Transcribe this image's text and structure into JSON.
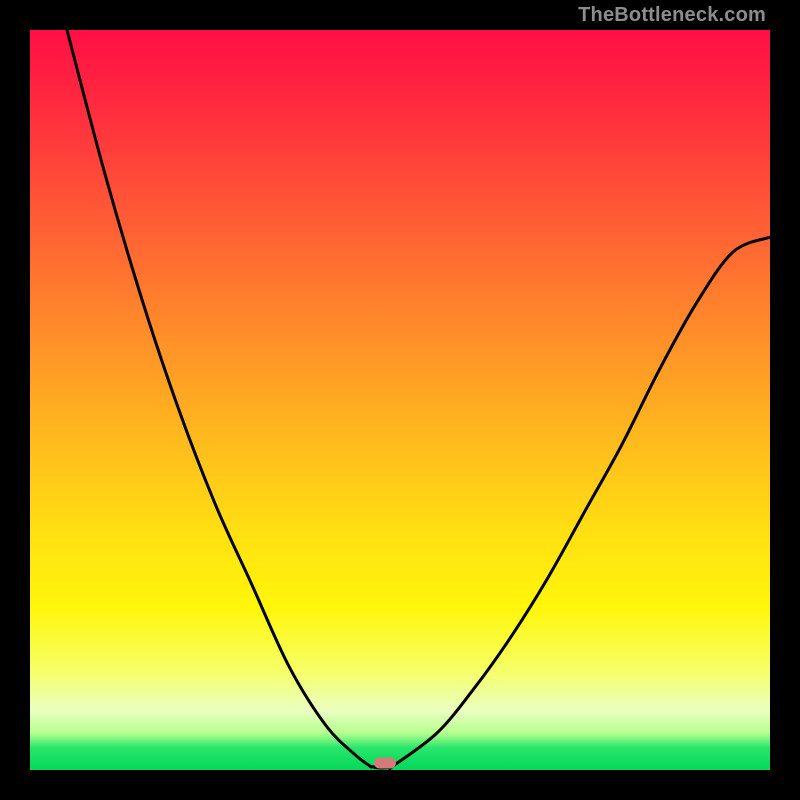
{
  "source_watermark": "TheBottleneck.com",
  "colors": {
    "frame": "#000000",
    "gradient_stops": [
      "#ff0f45",
      "#ff2a3f",
      "#ff5a36",
      "#ff8a2a",
      "#ffb91e",
      "#ffe012",
      "#fff60a",
      "#f7ff60",
      "#eaffc0",
      "#b6ff8f",
      "#28e66b",
      "#05d85a"
    ],
    "curve": "#000000",
    "marker": "#d47a7a"
  },
  "chart_data": {
    "type": "line",
    "title": "",
    "xlabel": "",
    "ylabel": "",
    "xlim": [
      0,
      100
    ],
    "ylim": [
      0,
      100
    ],
    "grid": false,
    "legend": false,
    "annotations": [
      {
        "kind": "marker",
        "x": 48,
        "y": 1,
        "shape": "pill",
        "color": "#d47a7a"
      }
    ],
    "series": [
      {
        "name": "left-branch",
        "x": [
          5,
          10,
          15,
          20,
          25,
          30,
          35,
          40,
          44,
          46
        ],
        "y": [
          100,
          81,
          64,
          49,
          36,
          25,
          14,
          6,
          2,
          0.5
        ]
      },
      {
        "name": "valley-floor",
        "x": [
          46,
          47,
          48,
          49
        ],
        "y": [
          0.5,
          0.3,
          0.3,
          0.5
        ]
      },
      {
        "name": "right-branch",
        "x": [
          49,
          55,
          60,
          65,
          70,
          75,
          80,
          85,
          90,
          95,
          100
        ],
        "y": [
          0.5,
          5,
          11,
          18,
          26,
          35,
          44,
          54,
          63,
          70,
          72
        ]
      }
    ],
    "notes": "Values are read off the image in percent-of-axis units; axes are unlabeled in the source so 0–100 normalized coordinates are used."
  }
}
